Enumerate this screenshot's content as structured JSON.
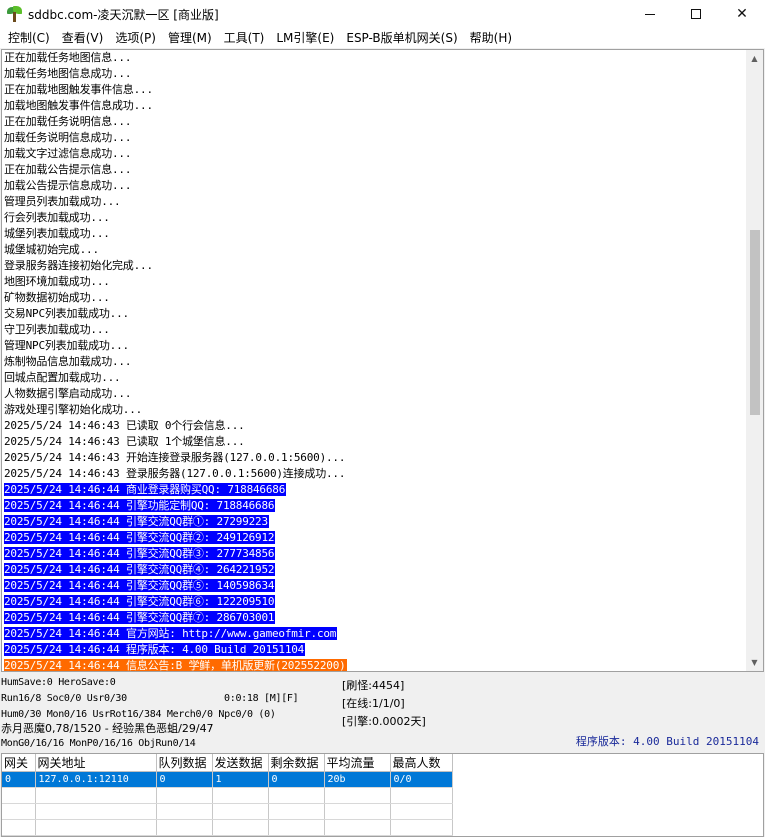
{
  "window": {
    "title": "sddbc.com-凌天沉默一区 [商业版]",
    "controls": {
      "minimize": "—",
      "maximize": "□",
      "close": "✕"
    }
  },
  "menu": [
    "控制(C)",
    "查看(V)",
    "选项(P)",
    "管理(M)",
    "工具(T)",
    "LM引擎(E)",
    "ESP-B版单机网关(S)",
    "帮助(H)"
  ],
  "log": [
    {
      "text": "正在加载任务地图信息...",
      "style": "normal"
    },
    {
      "text": "加载任务地图信息成功...",
      "style": "normal"
    },
    {
      "text": "正在加载地图触发事件信息...",
      "style": "normal"
    },
    {
      "text": "加载地图触发事件信息成功...",
      "style": "normal"
    },
    {
      "text": "正在加载任务说明信息...",
      "style": "normal"
    },
    {
      "text": "加载任务说明信息成功...",
      "style": "normal"
    },
    {
      "text": "加载文字过滤信息成功...",
      "style": "normal"
    },
    {
      "text": "正在加载公告提示信息...",
      "style": "normal"
    },
    {
      "text": "加载公告提示信息成功...",
      "style": "normal"
    },
    {
      "text": "管理员列表加载成功...",
      "style": "normal"
    },
    {
      "text": "行会列表加载成功...",
      "style": "normal"
    },
    {
      "text": "城堡列表加载成功...",
      "style": "normal"
    },
    {
      "text": "城堡城初始完成...",
      "style": "normal"
    },
    {
      "text": "登录服务器连接初始化完成...",
      "style": "normal"
    },
    {
      "text": "地图环境加载成功...",
      "style": "normal"
    },
    {
      "text": "矿物数据初始成功...",
      "style": "normal"
    },
    {
      "text": "交易NPC列表加载成功...",
      "style": "normal"
    },
    {
      "text": "守卫列表加载成功...",
      "style": "normal"
    },
    {
      "text": "管理NPC列表加载成功...",
      "style": "normal"
    },
    {
      "text": "炼制物品信息加载成功...",
      "style": "normal"
    },
    {
      "text": "回城点配置加载成功...",
      "style": "normal"
    },
    {
      "text": "人物数据引擎启动成功...",
      "style": "normal"
    },
    {
      "text": "游戏处理引擎初始化成功...",
      "style": "normal"
    },
    {
      "text": "2025/5/24 14:46:43 已读取 0个行会信息...",
      "style": "normal"
    },
    {
      "text": "2025/5/24 14:46:43 已读取 1个城堡信息...",
      "style": "normal"
    },
    {
      "text": "2025/5/24 14:46:43 开始连接登录服务器(127.0.0.1:5600)...",
      "style": "normal"
    },
    {
      "text": "2025/5/24 14:46:43 登录服务器(127.0.0.1:5600)连接成功...",
      "style": "normal"
    },
    {
      "text": "2025/5/24 14:46:44 商业登录器购买QQ: 718846686",
      "style": "blue"
    },
    {
      "text": "2025/5/24 14:46:44 引擎功能定制QQ: 718846686",
      "style": "blue"
    },
    {
      "text": "2025/5/24 14:46:44 引擎交流QQ群①: 27299223",
      "style": "blue"
    },
    {
      "text": "2025/5/24 14:46:44 引擎交流QQ群②: 249126912",
      "style": "blue"
    },
    {
      "text": "2025/5/24 14:46:44 引擎交流QQ群③: 277734856",
      "style": "blue"
    },
    {
      "text": "2025/5/24 14:46:44 引擎交流QQ群④: 264221952",
      "style": "blue"
    },
    {
      "text": "2025/5/24 14:46:44 引擎交流QQ群⑤: 140598634",
      "style": "blue"
    },
    {
      "text": "2025/5/24 14:46:44 引擎交流QQ群⑥: 122209510",
      "style": "blue"
    },
    {
      "text": "2025/5/24 14:46:44 引擎交流QQ群⑦: 286703001",
      "style": "blue"
    },
    {
      "text": "2025/5/24 14:46:44 官方网站: http://www.gameofmir.com",
      "style": "blue"
    },
    {
      "text": "2025/5/24 14:46:44 程序版本: 4.00 Build 20151104",
      "style": "blue"
    },
    {
      "text": "2025/5/24 14:46:44 信息公告:B 学鲜，单机版更新(202552200)",
      "style": "orange"
    }
  ],
  "status": {
    "line1": "HumSave:0 HeroSave:0",
    "line2": "Run16/8 Soc0/0 Usr0/30",
    "line2_time": "0:0:18 [M][F]",
    "line3": "Hum0/30 Mon0/16 UsrRot16/384 Merch0/0 Npc0/0 (0)",
    "line4": "赤月恶魔0,78/1520 - 经验黑色恶蛆/29/47",
    "line5": "MonG0/16/16 MonP0/16/16 ObjRun0/14",
    "refresh": "[刷怪:4454]",
    "online": "[在线:1/1/0]",
    "engine": "[引擎:0.0002天]",
    "version": "程序版本: 4.00 Build 20151104"
  },
  "gateway": {
    "headers": [
      "网关",
      "网关地址",
      "队列数据",
      "发送数据",
      "剩余数据",
      "平均流量",
      "最高人数"
    ],
    "rows": [
      [
        "0",
        "127.0.0.1:12110",
        "0",
        "1",
        "0",
        "20b",
        "0/0"
      ]
    ]
  }
}
